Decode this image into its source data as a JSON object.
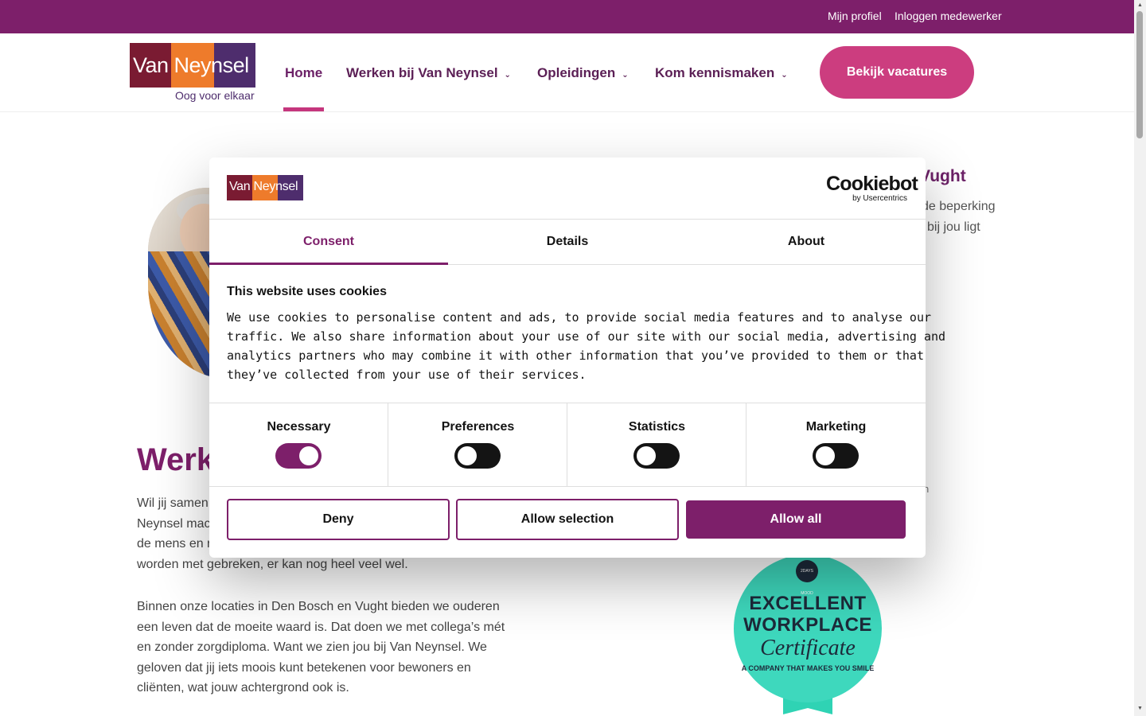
{
  "topbar": {
    "profile": "Mijn profiel",
    "login": "Inloggen medewerker"
  },
  "header": {
    "logo_text": "Van Neynsel",
    "logo_tagline": "Oog voor elkaar",
    "nav": [
      {
        "label": "Home",
        "active": true
      },
      {
        "label": "Werken bij Van Neynsel",
        "has_dropdown": true
      },
      {
        "label": "Opleidingen",
        "has_dropdown": true
      },
      {
        "label": "Kom kennismaken",
        "has_dropdown": true
      }
    ],
    "cta": "Bekijk vacatures"
  },
  "page": {
    "side_title": "Vught",
    "side_line1": "de beperking",
    "side_line2": "bij jou ligt",
    "side_small": "n",
    "heading": "Werk",
    "para1": [
      "Wil jij samen",
      "Neynsel mac",
      "de mens en r",
      "worden met gebreken, er kan nog heel veel wel."
    ],
    "para2": [
      "Binnen onze locaties in Den Bosch en Vught bieden we ouderen",
      "een leven dat de moeite waard is. Dat doen we met collega’s mét",
      "en zonder zorgdiploma. Want we zien jou bij Van Neynsel. We",
      "geloven dat jij iets moois kunt betekenen voor bewoners en",
      "cliënten, wat jouw achtergrond ook is."
    ],
    "badge": {
      "top": "2DAYS MOOD",
      "line1": "EXCELLENT",
      "line2": "WORKPLACE",
      "line3": "Certificate",
      "line4": "A COMPANY THAT MAKES YOU SMILE"
    }
  },
  "cookie": {
    "logo_text": "Van Neynsel",
    "brand": "Cookiebot",
    "brand_sub": "by Usercentrics",
    "tabs": [
      "Consent",
      "Details",
      "About"
    ],
    "active_tab": "Consent",
    "title": "This website uses cookies",
    "body": [
      "We use cookies to personalise content and ads, to provide social media features and to analyse our",
      "traffic. We also share information about your use of our site with our social media, advertising and",
      "analytics partners who may combine it with other information that you’ve provided to them or that",
      "they’ve collected from your use of their services."
    ],
    "toggles": [
      {
        "label": "Necessary",
        "on": true
      },
      {
        "label": "Preferences",
        "on": false
      },
      {
        "label": "Statistics",
        "on": false
      },
      {
        "label": "Marketing",
        "on": false
      }
    ],
    "buttons": {
      "deny": "Deny",
      "selection": "Allow selection",
      "all": "Allow all"
    }
  },
  "colors": {
    "brand_purple": "#7d1f6a",
    "cta_pink": "#cc3d7f",
    "badge_teal": "#3ed8bd"
  }
}
